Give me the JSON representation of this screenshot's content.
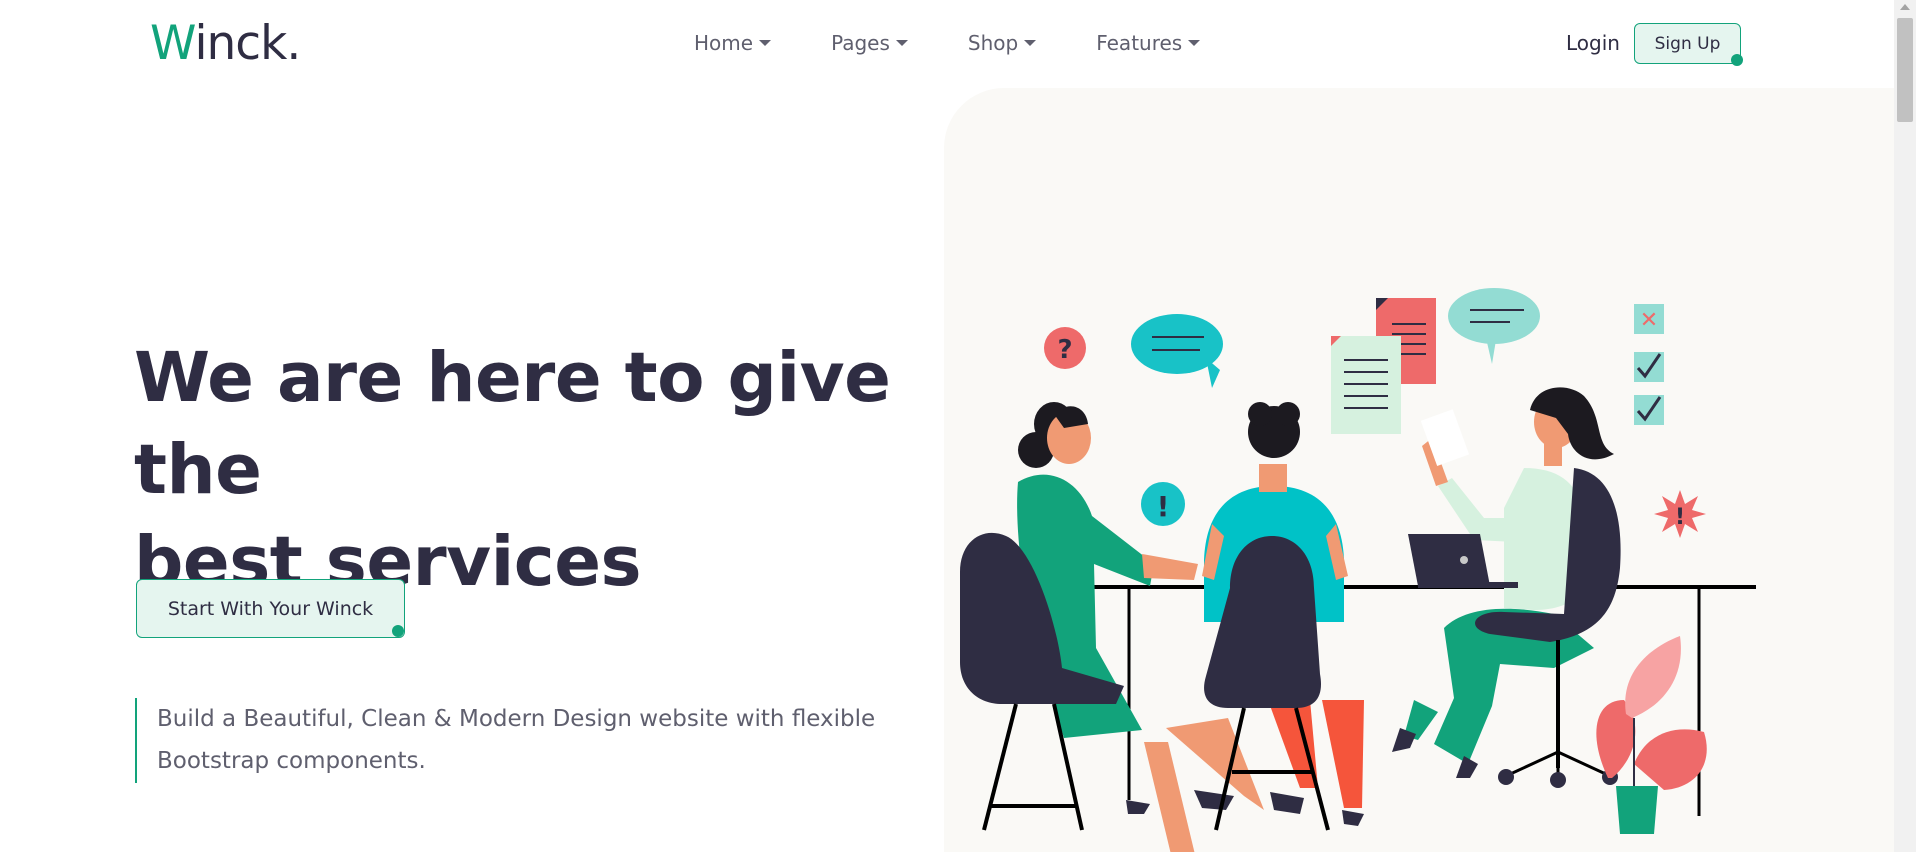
{
  "header": {
    "logo_first": "W",
    "logo_rest": "inck.",
    "nav": [
      {
        "label": "Home"
      },
      {
        "label": "Pages"
      },
      {
        "label": "Shop"
      },
      {
        "label": "Features"
      }
    ],
    "login_label": "Login",
    "signup_label": "Sign Up"
  },
  "hero": {
    "title_line1": "We are here to give the",
    "title_line2": "best services",
    "cta_label": "Start With Your Winck",
    "lead_line1": "Build a Beautiful, Clean & Modern Design website with flexible",
    "lead_line2": "Bootstrap components.",
    "illustration": {
      "icons": [
        "question-icon",
        "exclamation-icon",
        "chat-bubble-icon",
        "document-icon",
        "checkbox-icon",
        "alert-star-icon",
        "laptop-icon",
        "plant-icon"
      ],
      "question_mark": "?",
      "exclamation_mark": "!",
      "cross_mark": "✕",
      "check_mark": "✓"
    }
  },
  "colors": {
    "accent": "#12a37b",
    "accent_light": "#e5f5ef",
    "heading": "#2f2d43",
    "muted": "#5f5f6e",
    "art_bg": "#faf9f6"
  }
}
